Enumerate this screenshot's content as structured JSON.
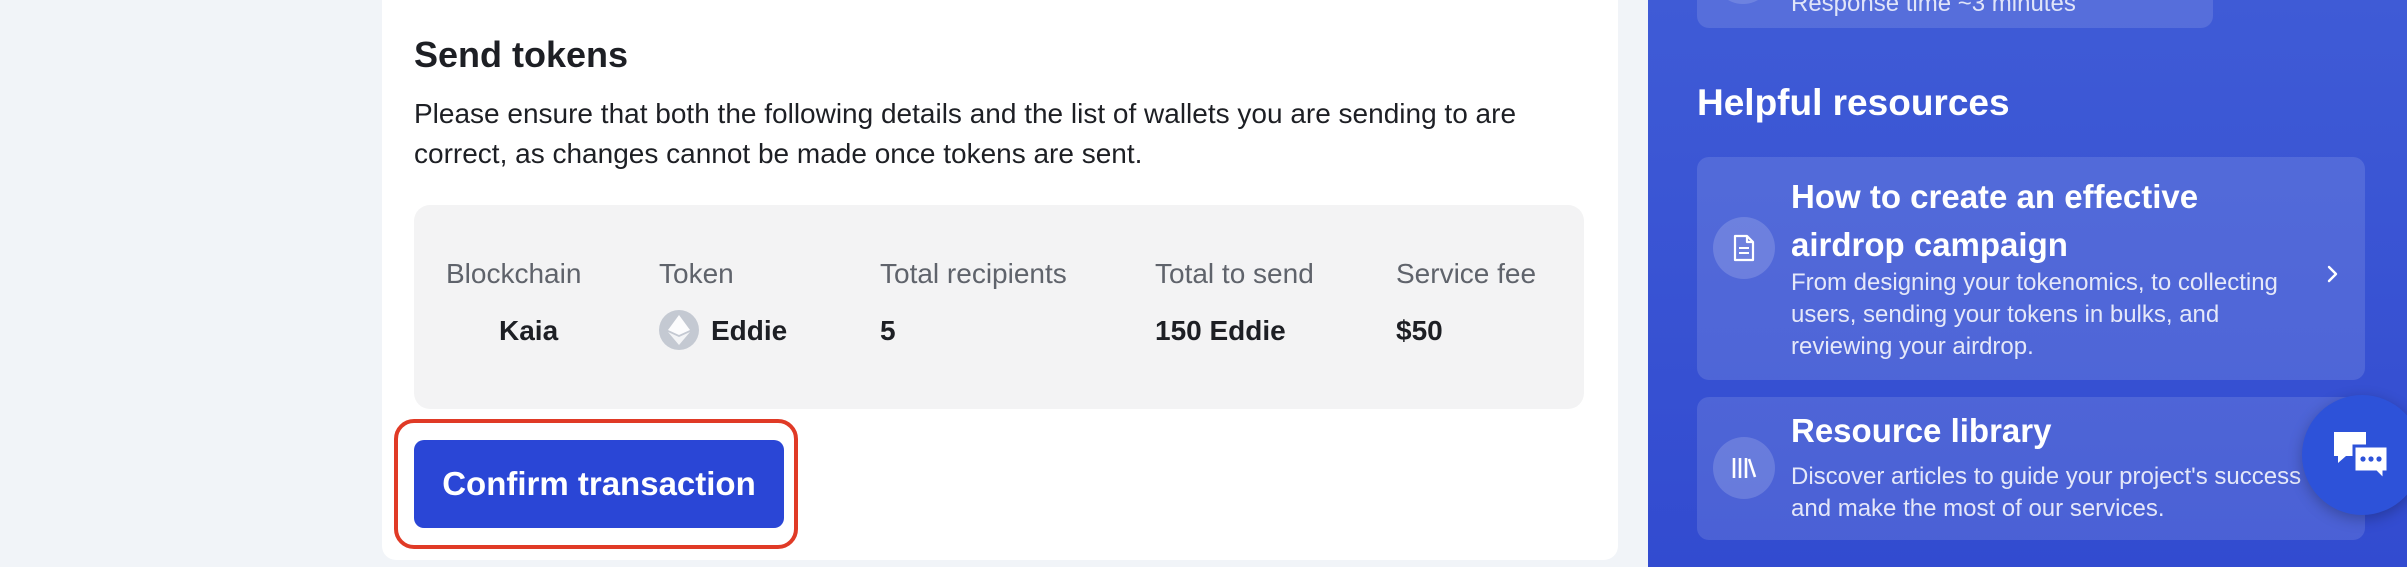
{
  "send": {
    "title": "Send tokens",
    "description": "Please ensure that both the following details and the list of wallets you are sending to are correct, as changes cannot be made once tokens are sent.",
    "summary": {
      "blockchain_label": "Blockchain",
      "blockchain_value": "Kaia",
      "token_label": "Token",
      "token_value": "Eddie",
      "token_icon": "ethereum-icon",
      "recipients_label": "Total recipients",
      "recipients_value": "5",
      "total_label": "Total to send",
      "total_value": "150 Eddie",
      "fee_label": "Service fee",
      "fee_value": "$50"
    },
    "confirm_label": "Confirm transaction"
  },
  "sidebar": {
    "top_tile_text": "Response time ~3 minutes",
    "heading": "Helpful resources",
    "resources": [
      {
        "title": "How to create an effective airdrop campaign",
        "description": "From designing your tokenomics, to collecting users, sending your tokens in bulks, and reviewing your airdrop.",
        "icon": "document-icon"
      },
      {
        "title": "Resource library",
        "description": "Discover articles to guide your project's success and make the most of our services.",
        "icon": "library-icon"
      }
    ]
  },
  "chat": {
    "icon": "chat-icon"
  },
  "colors": {
    "accent": "#2a46d6",
    "highlight_ring": "#e03a26",
    "sidebar_bg": "#3f5bd6"
  }
}
